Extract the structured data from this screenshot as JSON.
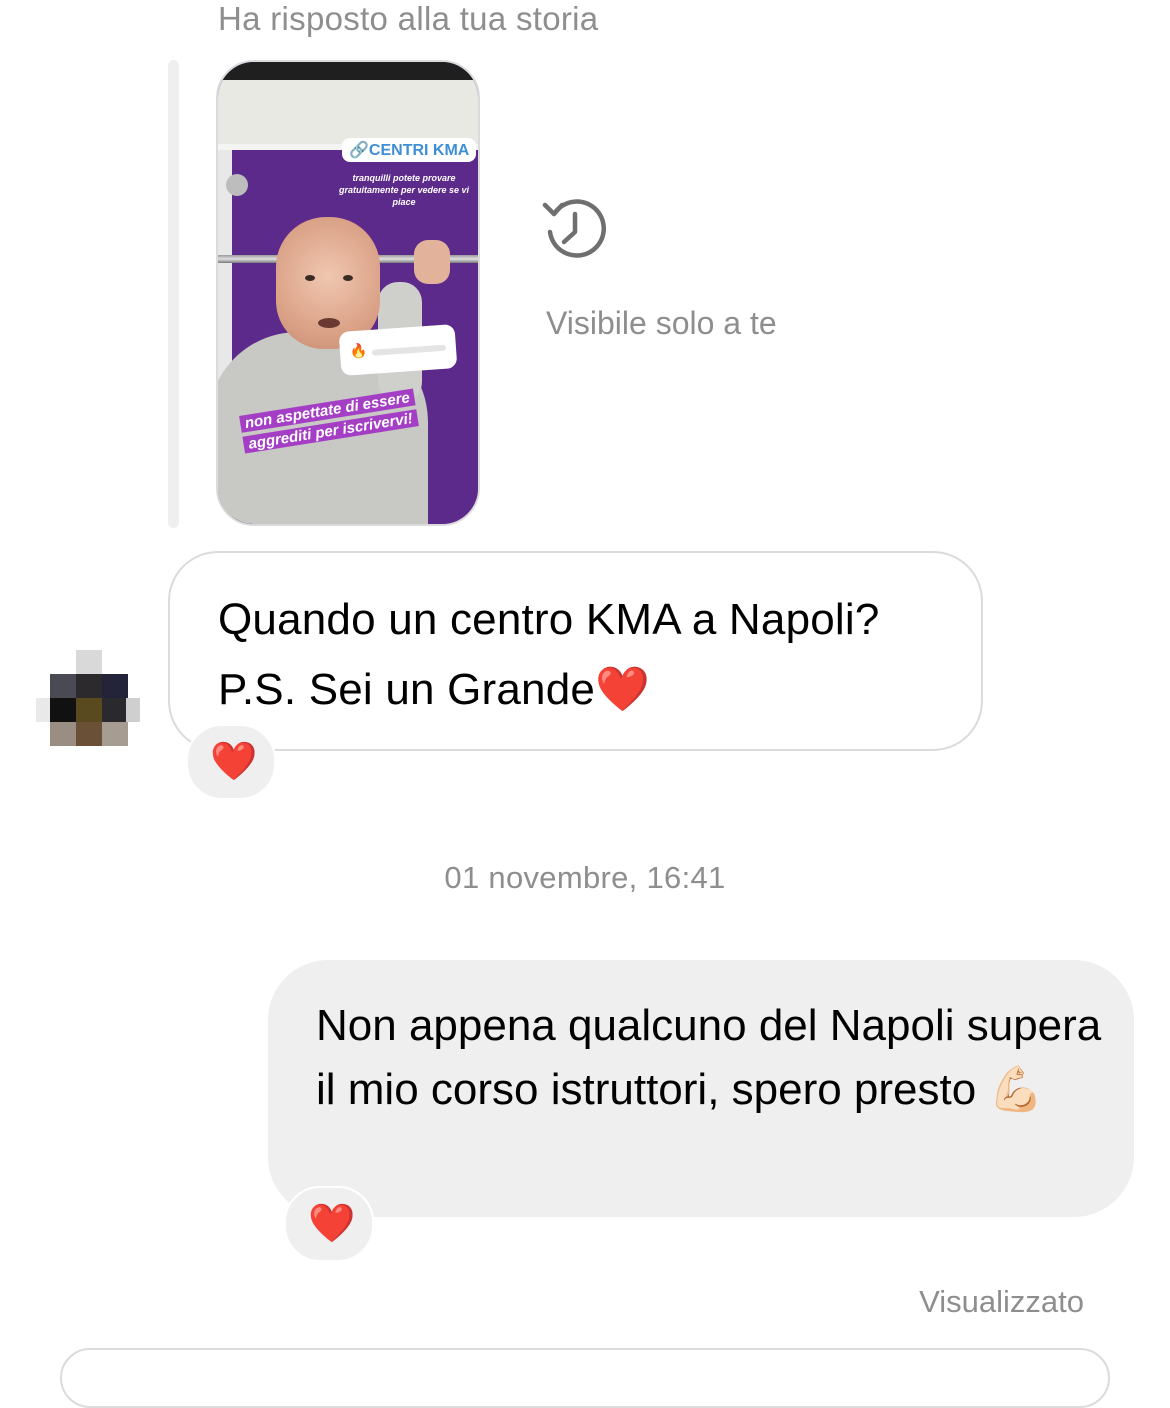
{
  "reply_header": "Ha risposto alla tua storia",
  "story": {
    "link_chip": "CENTRI KMA",
    "small_text": "tranquilli potete provare gratuitamente per vedere se vi piace",
    "caption": "non aspettate di essere aggrediti per iscrivervi!"
  },
  "story_status": {
    "icon": "clock-history-icon",
    "text": "Visibile solo a te"
  },
  "incoming_message": {
    "line1": "Quando un centro KMA a Napoli?",
    "line2": "P.S. Sei un Grande",
    "emoji": "❤️",
    "reaction": "❤️"
  },
  "timestamp": "01 novembre, 16:41",
  "outgoing_message": {
    "text": "Non appena qualcuno del Napoli supera il mio corso istruttori, spero presto",
    "emoji": "💪🏻",
    "reaction": "❤️"
  },
  "seen_status": "Visualizzato",
  "colors": {
    "secondary_text": "#8e8e8e",
    "bubble_out_bg": "#efefef",
    "bubble_in_border": "#dbdbdb",
    "story_purple": "#5c2a8a",
    "link_blue": "#3f8fd6"
  }
}
